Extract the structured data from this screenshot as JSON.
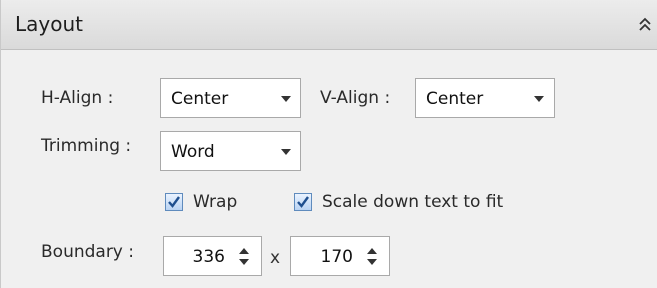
{
  "panel": {
    "title": "Layout",
    "collapse_icon": "double-chevron-up-icon"
  },
  "halign": {
    "label": "H-Align :",
    "value": "Center"
  },
  "valign": {
    "label": "V-Align :",
    "value": "Center"
  },
  "trimming": {
    "label": "Trimming :",
    "value": "Word"
  },
  "options": {
    "wrap": {
      "label": "Wrap",
      "checked": true
    },
    "scale_down": {
      "label": "Scale down text to fit",
      "checked": true
    }
  },
  "boundary": {
    "label": "Boundary :",
    "width": "336",
    "separator": "x",
    "height": "170"
  }
}
